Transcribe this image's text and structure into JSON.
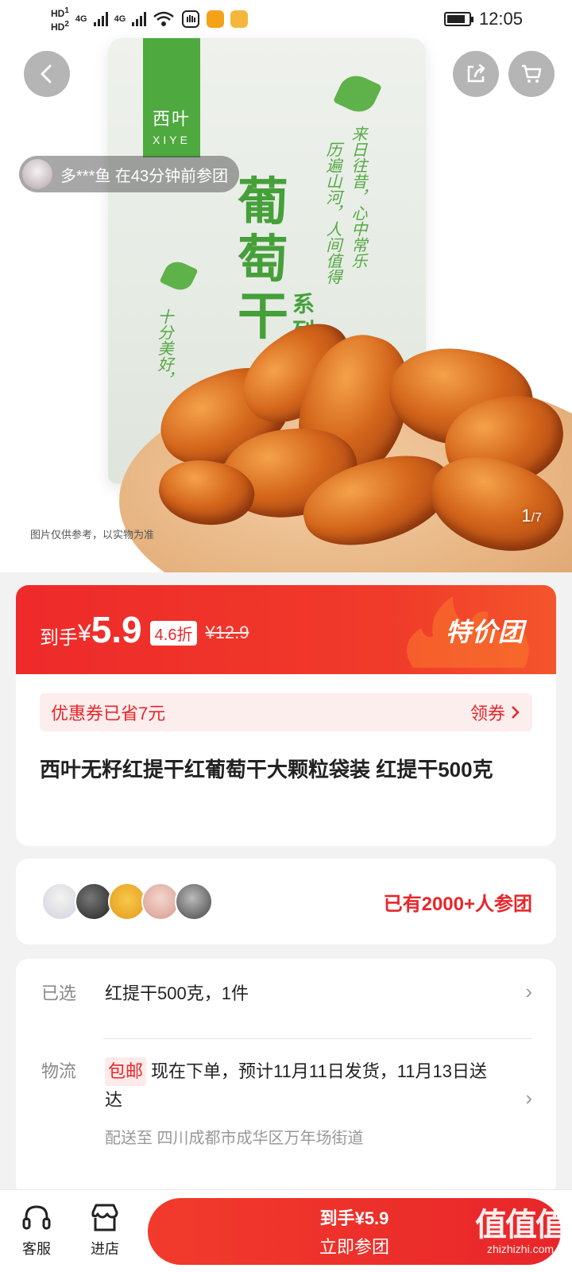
{
  "status_bar": {
    "hd_label": "HD",
    "sim1": "1",
    "sim2": "2",
    "network_label": "4G",
    "time": "12:05"
  },
  "hero": {
    "brand_cn": "西叶",
    "brand_en": "XIYE",
    "product_title_chars": "葡萄干",
    "series_text": "系列",
    "calligraphy_1": "来日往昔，心中常乐",
    "calligraphy_2": "历遍山河，人间值得",
    "calligraphy_3": "十分美好，",
    "disclaimer": "图片仅供参考，以实物为准",
    "pager_current": "1",
    "pager_total": "/7",
    "ticker_text": "多***鱼  在43分钟前参团"
  },
  "price": {
    "label": "到手",
    "yen": "¥",
    "value": "5.9",
    "discount": "4.6折",
    "original": "¥12.9",
    "badge": "特价团"
  },
  "coupon": {
    "text": "优惠券已省7元",
    "action": "领券"
  },
  "product": {
    "title": "西叶无籽红提干红葡萄干大颗粒袋装 红提干500克"
  },
  "group": {
    "count_text": "已有2000+人参团"
  },
  "info": {
    "selected_label": "已选",
    "selected_value": "红提干500克，1件",
    "logistics_label": "物流",
    "shipping_tag": "包邮",
    "logistics_value": "现在下单，预计11月11日发货，11月13日送达",
    "ship_to": "配送至  四川成都市成华区万年场街道"
  },
  "bottom_bar": {
    "service_label": "客服",
    "store_label": "进店",
    "buy_line1": "到手¥5.9",
    "buy_line2": "立即参团",
    "watermark_line1": "值值值",
    "watermark_line2": "zhizhizhi.com"
  },
  "colors": {
    "accent_red": "#e8262a",
    "brand_green": "#4ea93f"
  }
}
